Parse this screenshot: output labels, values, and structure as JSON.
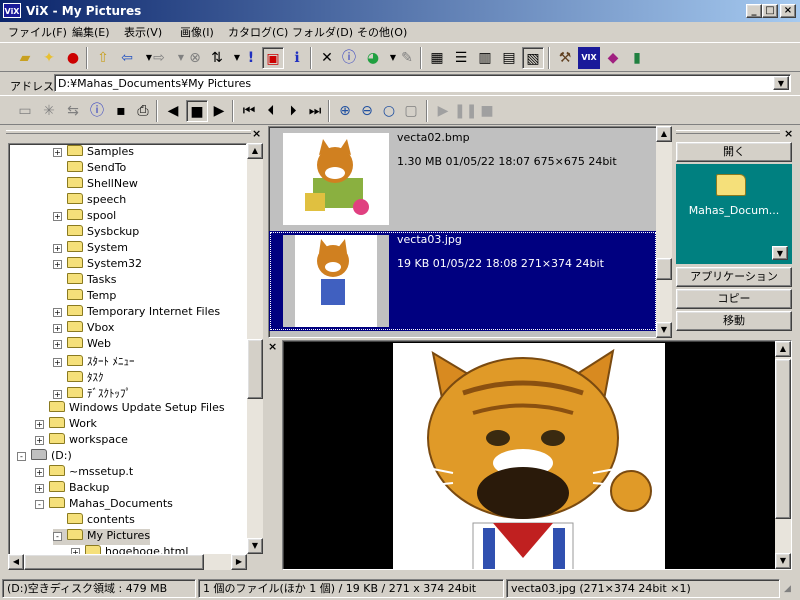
{
  "window": {
    "title": "ViX - My Pictures",
    "app_icon": "ViX"
  },
  "menu": [
    "ファイル(F)",
    "編集(E)",
    "表示(V)",
    "画像(I)",
    "カタログ(C)",
    "フォルダ(D)",
    "その他(O)"
  ],
  "address": {
    "label": "アドレス",
    "value": "D:¥Mahas_Documents¥My Pictures"
  },
  "tree": [
    {
      "label": "Samples",
      "indent": 2,
      "expander": "+"
    },
    {
      "label": "SendTo",
      "indent": 2,
      "expander": ""
    },
    {
      "label": "ShellNew",
      "indent": 2,
      "expander": ""
    },
    {
      "label": "speech",
      "indent": 2,
      "expander": ""
    },
    {
      "label": "spool",
      "indent": 2,
      "expander": "+"
    },
    {
      "label": "Sysbckup",
      "indent": 2,
      "expander": ""
    },
    {
      "label": "System",
      "indent": 2,
      "expander": "+"
    },
    {
      "label": "System32",
      "indent": 2,
      "expander": "+"
    },
    {
      "label": "Tasks",
      "indent": 2,
      "expander": ""
    },
    {
      "label": "Temp",
      "indent": 2,
      "expander": ""
    },
    {
      "label": "Temporary Internet Files",
      "indent": 2,
      "expander": "+"
    },
    {
      "label": "Vbox",
      "indent": 2,
      "expander": "+"
    },
    {
      "label": "Web",
      "indent": 2,
      "expander": "+"
    },
    {
      "label": "ｽﾀｰﾄ ﾒﾆｭｰ",
      "indent": 2,
      "expander": "+"
    },
    {
      "label": "ﾀｽｸ",
      "indent": 2,
      "expander": ""
    },
    {
      "label": "ﾃﾞｽｸﾄｯﾌﾟ",
      "indent": 2,
      "expander": "+"
    },
    {
      "label": "Windows Update Setup Files",
      "indent": 1,
      "expander": ""
    },
    {
      "label": "Work",
      "indent": 1,
      "expander": "+"
    },
    {
      "label": "workspace",
      "indent": 1,
      "expander": "+"
    },
    {
      "label": "(D:)",
      "indent": 0,
      "expander": "-"
    },
    {
      "label": "~mssetup.t",
      "indent": 1,
      "expander": "+"
    },
    {
      "label": "Backup",
      "indent": 1,
      "expander": "+"
    },
    {
      "label": "Mahas_Documents",
      "indent": 1,
      "expander": "-"
    },
    {
      "label": "contents",
      "indent": 2,
      "expander": ""
    },
    {
      "label": "My Pictures",
      "indent": 2,
      "expander": "-"
    },
    {
      "label": "hogehoge.html",
      "indent": 3,
      "expander": "+"
    }
  ],
  "thumbnails": [
    {
      "filename": "vecta02.bmp",
      "info": "1.30 MB  01/05/22 18:07  675×675  24bit",
      "selected": false
    },
    {
      "filename": "vecta03.jpg",
      "info": "19 KB  01/05/22 18:08  271×374  24bit",
      "selected": true
    }
  ],
  "right_panel": {
    "open_label": "開く",
    "folder_label": "Mahas_Docum...",
    "buttons": [
      "アプリケーション",
      "コピー",
      "移動"
    ]
  },
  "status": {
    "free_space": "(D:)空きディスク領域 : 479 MB",
    "selection": "1 個のファイル(ほか 1 個) / 19 KB / 271 x 374 24bit",
    "image": "vecta03.jpg (271×374 24bit ×1)"
  },
  "colors": {
    "title_start": "#0a246a",
    "title_end": "#a6caf0",
    "selection": "#000080",
    "teal": "#008080"
  }
}
